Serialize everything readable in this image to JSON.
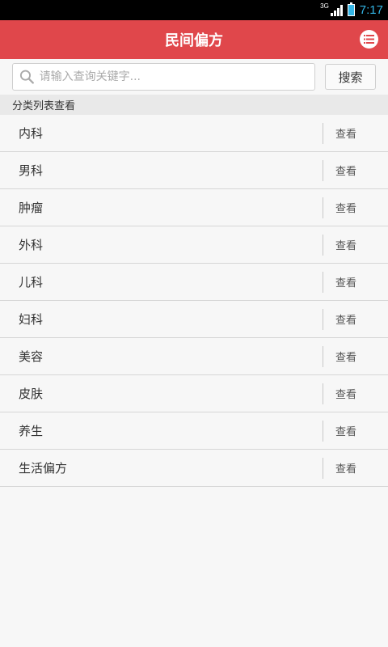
{
  "status_bar": {
    "network": "3G",
    "time": "7:17"
  },
  "header": {
    "title": "民间偏方"
  },
  "search": {
    "placeholder": "请输入查询关键字...",
    "button_label": "搜索"
  },
  "section": {
    "title": "分类列表查看"
  },
  "categories": [
    {
      "label": "内科",
      "action": "查看"
    },
    {
      "label": "男科",
      "action": "查看"
    },
    {
      "label": "肿瘤",
      "action": "查看"
    },
    {
      "label": "外科",
      "action": "查看"
    },
    {
      "label": "儿科",
      "action": "查看"
    },
    {
      "label": "妇科",
      "action": "查看"
    },
    {
      "label": "美容",
      "action": "查看"
    },
    {
      "label": "皮肤",
      "action": "查看"
    },
    {
      "label": "养生",
      "action": "查看"
    },
    {
      "label": "生活偏方",
      "action": "查看"
    }
  ],
  "colors": {
    "accent": "#e0474b",
    "status_time": "#33b5e5"
  }
}
